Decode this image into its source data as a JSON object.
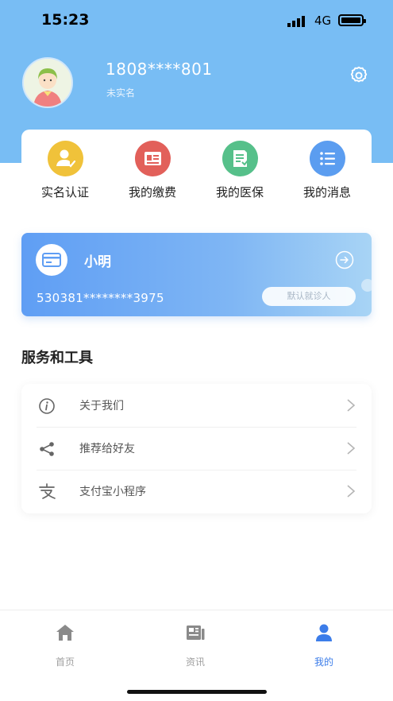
{
  "status_bar": {
    "time": "15:23",
    "network": "4G"
  },
  "profile": {
    "phone": "1808****801",
    "status": "未实名"
  },
  "quick_actions": [
    {
      "label": "实名认证",
      "icon": "user-verify-icon",
      "color": "#f0c23a"
    },
    {
      "label": "我的缴费",
      "icon": "id-card-icon",
      "color": "#e2605a"
    },
    {
      "label": "我的医保",
      "icon": "document-icon",
      "color": "#56c08a"
    },
    {
      "label": "我的消息",
      "icon": "list-icon",
      "color": "#5b9df0"
    }
  ],
  "patient_card": {
    "name": "小明",
    "id_number": "530381********3975",
    "default_label": "默认就诊人"
  },
  "services": {
    "title": "服务和工具",
    "items": [
      {
        "label": "关于我们",
        "icon": "info-icon"
      },
      {
        "label": "推荐给好友",
        "icon": "share-icon"
      },
      {
        "label": "支付宝小程序",
        "icon": "alipay-icon"
      }
    ]
  },
  "tabs": [
    {
      "label": "首页",
      "icon": "home-icon",
      "active": false
    },
    {
      "label": "资讯",
      "icon": "news-icon",
      "active": false
    },
    {
      "label": "我的",
      "icon": "person-icon",
      "active": true
    }
  ],
  "colors": {
    "header": "#78bdf4",
    "accent": "#3c7de9",
    "card_start": "#5f9ef4",
    "card_end": "#a8d4f5"
  }
}
